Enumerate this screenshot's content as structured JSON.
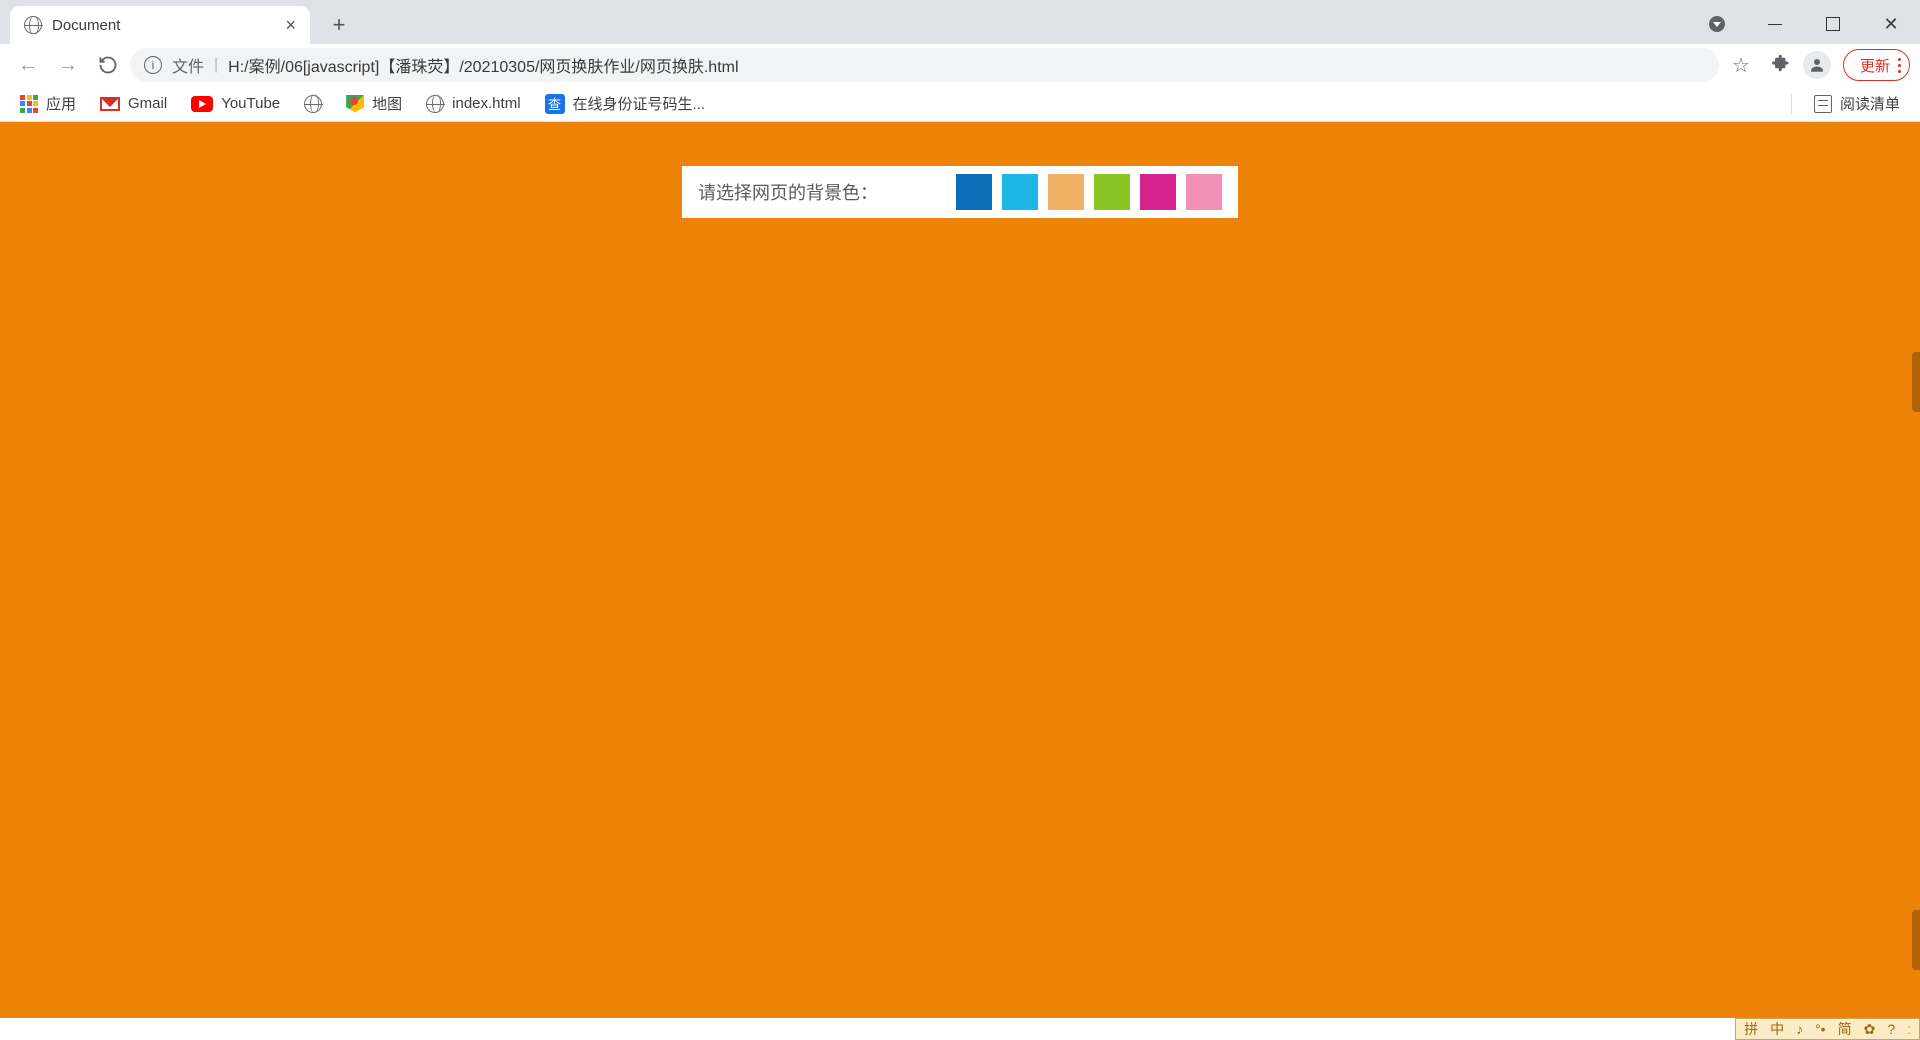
{
  "tab": {
    "title": "Document"
  },
  "address": {
    "prefix": "文件",
    "path": "H:/案例/06[javascript]【潘珠荧】/20210305/网页换肤作业/网页换肤.html"
  },
  "update_button": "更新",
  "bookmarks": {
    "apps": "应用",
    "gmail": "Gmail",
    "youtube": "YouTube",
    "maps": "地图",
    "index": "index.html",
    "idgen": "在线身份证号码生...",
    "reading_list": "阅读清单"
  },
  "page": {
    "background": "#ed8308",
    "prompt": "请选择网页的背景色：",
    "swatches": [
      "#0a6fb8",
      "#1db6e2",
      "#eeb165",
      "#88c425",
      "#d6248c",
      "#f18fb6"
    ]
  },
  "ime": {
    "items": [
      "拼",
      "中",
      "♪",
      "°•",
      "简",
      "✿",
      "?",
      "ː"
    ]
  }
}
